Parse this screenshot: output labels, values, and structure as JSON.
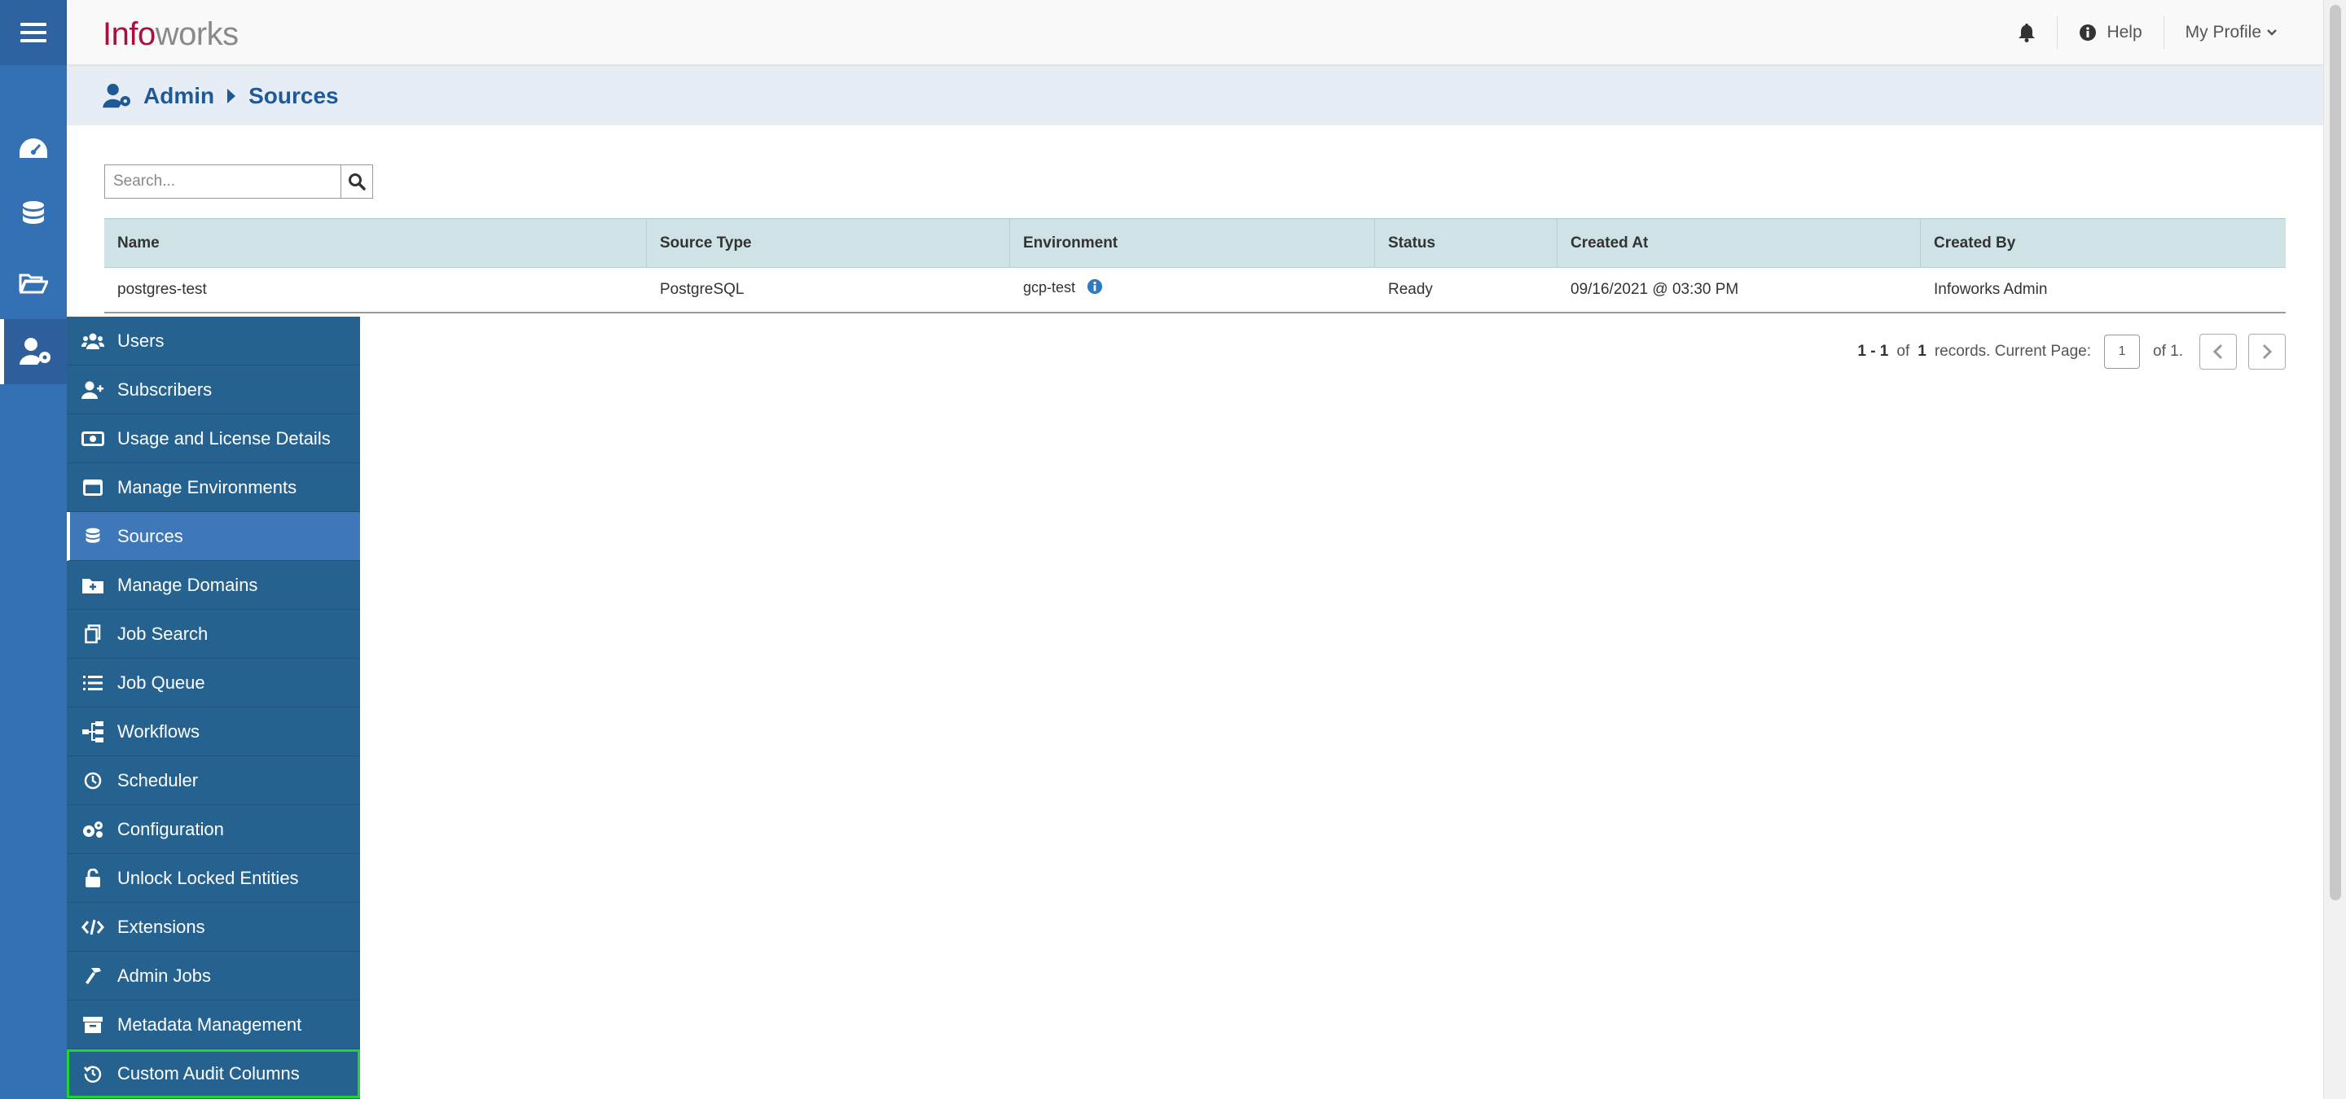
{
  "header": {
    "logo_part1": "Info",
    "logo_part2": "works",
    "help_label": "Help",
    "profile_label": "My Profile"
  },
  "breadcrumb": {
    "root": "Admin",
    "current": "Sources"
  },
  "search": {
    "placeholder": "Search..."
  },
  "table": {
    "columns": [
      "Name",
      "Source Type",
      "Environment",
      "Status",
      "Created At",
      "Created By"
    ],
    "rows": [
      {
        "name": "postgres-test",
        "source_type": "PostgreSQL",
        "environment": "gcp-test",
        "status": "Ready",
        "created_at": "09/16/2021 @ 03:30 PM",
        "created_by": "Infoworks Admin"
      }
    ]
  },
  "pagination": {
    "range": "1 - 1",
    "of_label": "of",
    "total": "1",
    "records_label": "records. Current Page:",
    "current_page": "1",
    "of_pages": "of 1."
  },
  "admin_menu": {
    "items": [
      {
        "label": "Users",
        "icon": "users-icon"
      },
      {
        "label": "Subscribers",
        "icon": "user-plus-icon"
      },
      {
        "label": "Usage and License Details",
        "icon": "money-bill-icon"
      },
      {
        "label": "Manage Environments",
        "icon": "window-icon"
      },
      {
        "label": "Sources",
        "icon": "database-icon"
      },
      {
        "label": "Manage Domains",
        "icon": "folder-plus-icon"
      },
      {
        "label": "Job Search",
        "icon": "copy-icon"
      },
      {
        "label": "Job Queue",
        "icon": "list-icon"
      },
      {
        "label": "Workflows",
        "icon": "sitemap-icon"
      },
      {
        "label": "Scheduler",
        "icon": "clock-icon"
      },
      {
        "label": "Configuration",
        "icon": "cogs-icon"
      },
      {
        "label": "Unlock Locked Entities",
        "icon": "unlock-icon"
      },
      {
        "label": "Extensions",
        "icon": "code-icon"
      },
      {
        "label": "Admin Jobs",
        "icon": "hammer-icon"
      },
      {
        "label": "Metadata Management",
        "icon": "archive-icon"
      },
      {
        "label": "Custom Audit Columns",
        "icon": "history-icon"
      }
    ],
    "active_item": "Sources",
    "highlighted_item": "Custom Audit Columns"
  },
  "colors": {
    "rail": "#3470b4",
    "menu": "#26628f",
    "menu_active": "#3e78b8",
    "brand": "#a5123c",
    "table_header": "#cfe3e7",
    "highlight": "#22d430"
  }
}
